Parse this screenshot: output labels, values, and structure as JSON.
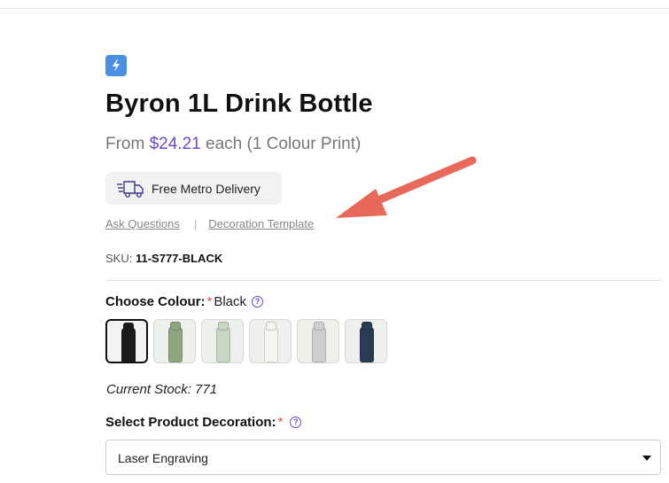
{
  "product": {
    "title": "Byron 1L Drink Bottle",
    "price_prefix": "From ",
    "price": "$24.21",
    "price_suffix": " each (1 Colour Print)"
  },
  "delivery": {
    "label": "Free Metro Delivery",
    "icon": "delivery-truck-icon"
  },
  "links": {
    "ask": "Ask Questions",
    "separator": "|",
    "template": "Decoration Template"
  },
  "sku": {
    "label": "SKU:",
    "value": "11-S777-BLACK"
  },
  "colour": {
    "label": "Choose Colour:",
    "required_mark": "*",
    "selected": "Black",
    "help": "?",
    "swatches": [
      {
        "name": "Black",
        "color": "#1c1c1c",
        "selected": true
      },
      {
        "name": "Sage",
        "color": "#8fa582",
        "selected": false
      },
      {
        "name": "Mint",
        "color": "#c9d6c4",
        "selected": false
      },
      {
        "name": "White",
        "color": "#f4f4f2",
        "selected": false
      },
      {
        "name": "Grey",
        "color": "#cfcfcf",
        "selected": false
      },
      {
        "name": "Navy",
        "color": "#2b3a55",
        "selected": false
      }
    ]
  },
  "stock": "Current Stock: 771",
  "decoration": {
    "label": "Select Product Decoration:",
    "required_mark": "*",
    "help": "?",
    "selected": "Laser Engraving"
  },
  "colors": {
    "accent": "#6a4bc4",
    "annotation_arrow": "#e8695a",
    "brand_icon": "#4a90e2"
  }
}
